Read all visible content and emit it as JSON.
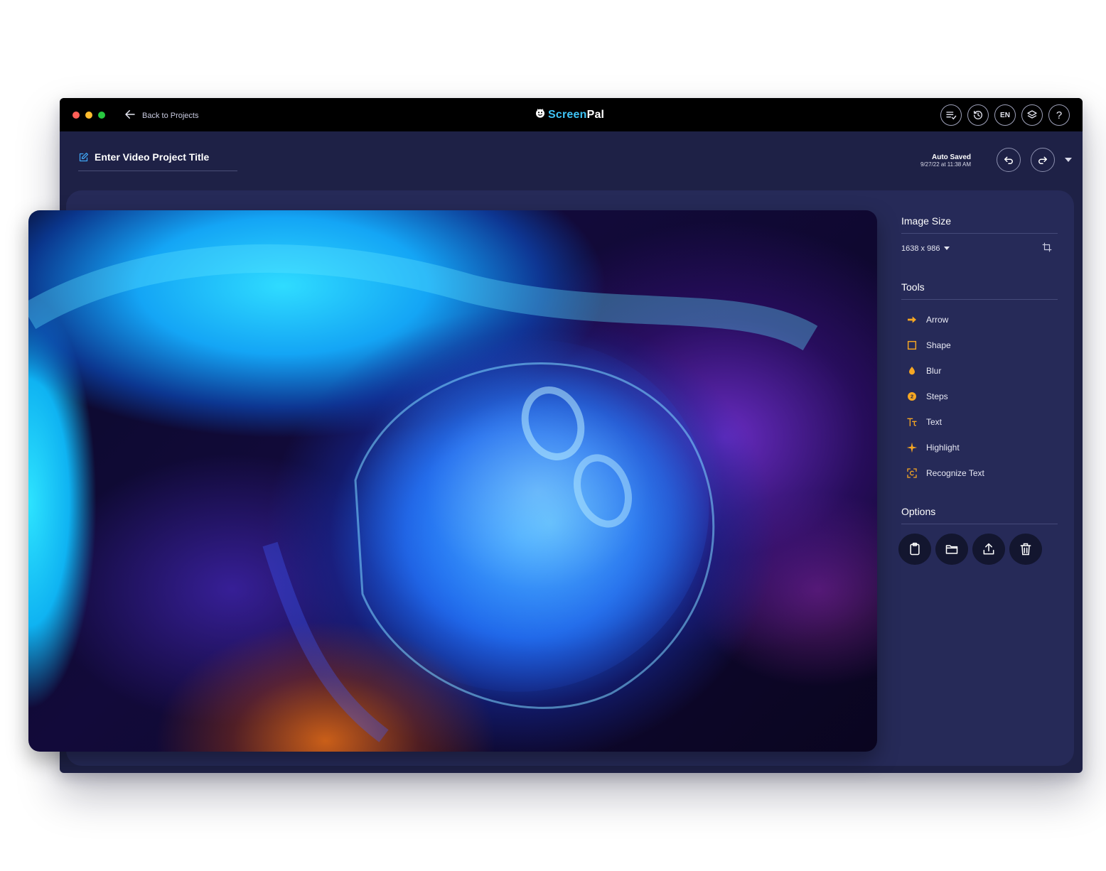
{
  "header": {
    "back_label": "Back to Projects",
    "logo_primary": "Screen",
    "logo_secondary": "Pal",
    "icons": [
      "playlist-check-icon",
      "history-icon",
      "language-icon",
      "layers-icon",
      "help-icon"
    ],
    "language": "EN",
    "help": "?"
  },
  "project": {
    "title_placeholder": "Enter Video Project Title",
    "autosave_label": "Auto Saved",
    "autosave_time": "9/27/22 at 11:38 AM"
  },
  "panel": {
    "image_size_title": "Image Size",
    "image_size_value": "1638 x 986",
    "tools_title": "Tools",
    "tools": [
      {
        "label": "Arrow",
        "icon": "arrow-icon"
      },
      {
        "label": "Shape",
        "icon": "shape-icon"
      },
      {
        "label": "Blur",
        "icon": "blur-icon"
      },
      {
        "label": "Steps",
        "icon": "steps-icon"
      },
      {
        "label": "Text",
        "icon": "text-icon"
      },
      {
        "label": "Highlight",
        "icon": "highlight-icon"
      },
      {
        "label": "Recognize Text",
        "icon": "recognize-text-icon"
      }
    ],
    "options_title": "Options",
    "options": [
      "clipboard-icon",
      "folder-icon",
      "upload-icon",
      "trash-icon"
    ]
  },
  "colors": {
    "accent": "#f5a623",
    "brand": "#3fc3f5",
    "window_bg": "#1e2146",
    "panel_bg": "#262a58",
    "titlebar": "#000000"
  }
}
